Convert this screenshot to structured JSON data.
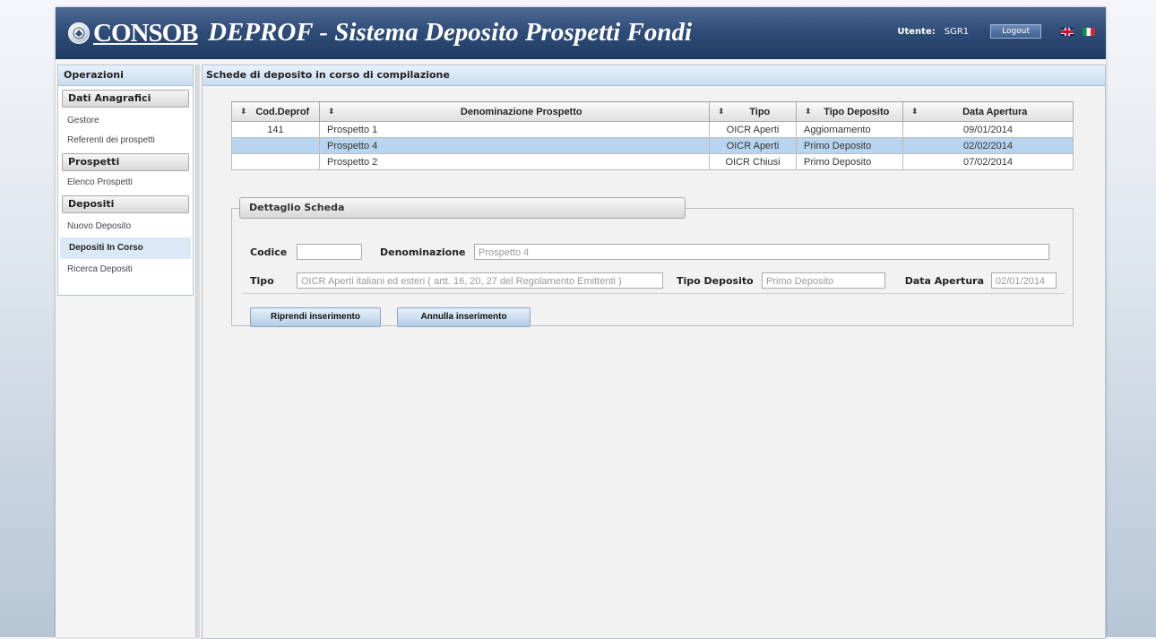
{
  "header": {
    "logo_text": "CONSOB",
    "app_title": "DEPROF - Sistema Deposito Prospetti Fondi",
    "user_label": "Utente:",
    "user_value": "SGR1",
    "logout_label": "Logout"
  },
  "sidebar": {
    "title": "Operazioni",
    "groups": [
      {
        "label": "Dati Anagrafici",
        "items": [
          "Gestore",
          "Referenti dei prospetti"
        ]
      },
      {
        "label": "Prospetti",
        "items": [
          "Elenco Prospetti"
        ]
      },
      {
        "label": "Depositi",
        "items": [
          "Nuovo Deposito",
          "Depositi In Corso",
          "Ricerca Depositi"
        ]
      }
    ],
    "active_item": "Depositi In Corso"
  },
  "main": {
    "title": "Schede di deposito in corso di compilazione",
    "table": {
      "columns": [
        "Cod.Deprof",
        "Denominazione Prospetto",
        "Tipo",
        "Tipo Deposito",
        "Data Apertura"
      ],
      "rows": [
        [
          "141",
          "Prospetto 1",
          "OICR Aperti",
          "Aggiornamento",
          "09/01/2014"
        ],
        [
          "",
          "Prospetto 4",
          "OICR Aperti",
          "Primo Deposito",
          "02/02/2014"
        ],
        [
          "",
          "Prospetto 2",
          "OICR Chiusi",
          "Primo Deposito",
          "07/02/2014"
        ]
      ],
      "selected_row": 1
    },
    "detail": {
      "legend": "Dettaglio Scheda",
      "codice_label": "Codice",
      "codice_value": "",
      "denominazione_label": "Denominazione",
      "denominazione_value": "Prospetto 4",
      "tipo_label": "Tipo",
      "tipo_value": "OICR Aperti italiani ed esteri ( artt. 16, 20, 27 del Regolamento Emittenti )",
      "tipo_deposito_label": "Tipo Deposito",
      "tipo_deposito_value": "Primo Deposito",
      "data_apertura_label": "Data Apertura",
      "data_apertura_value": "02/01/2014",
      "resume_button": "Riprendi inserimento",
      "cancel_button": "Annulla inserimento"
    }
  }
}
